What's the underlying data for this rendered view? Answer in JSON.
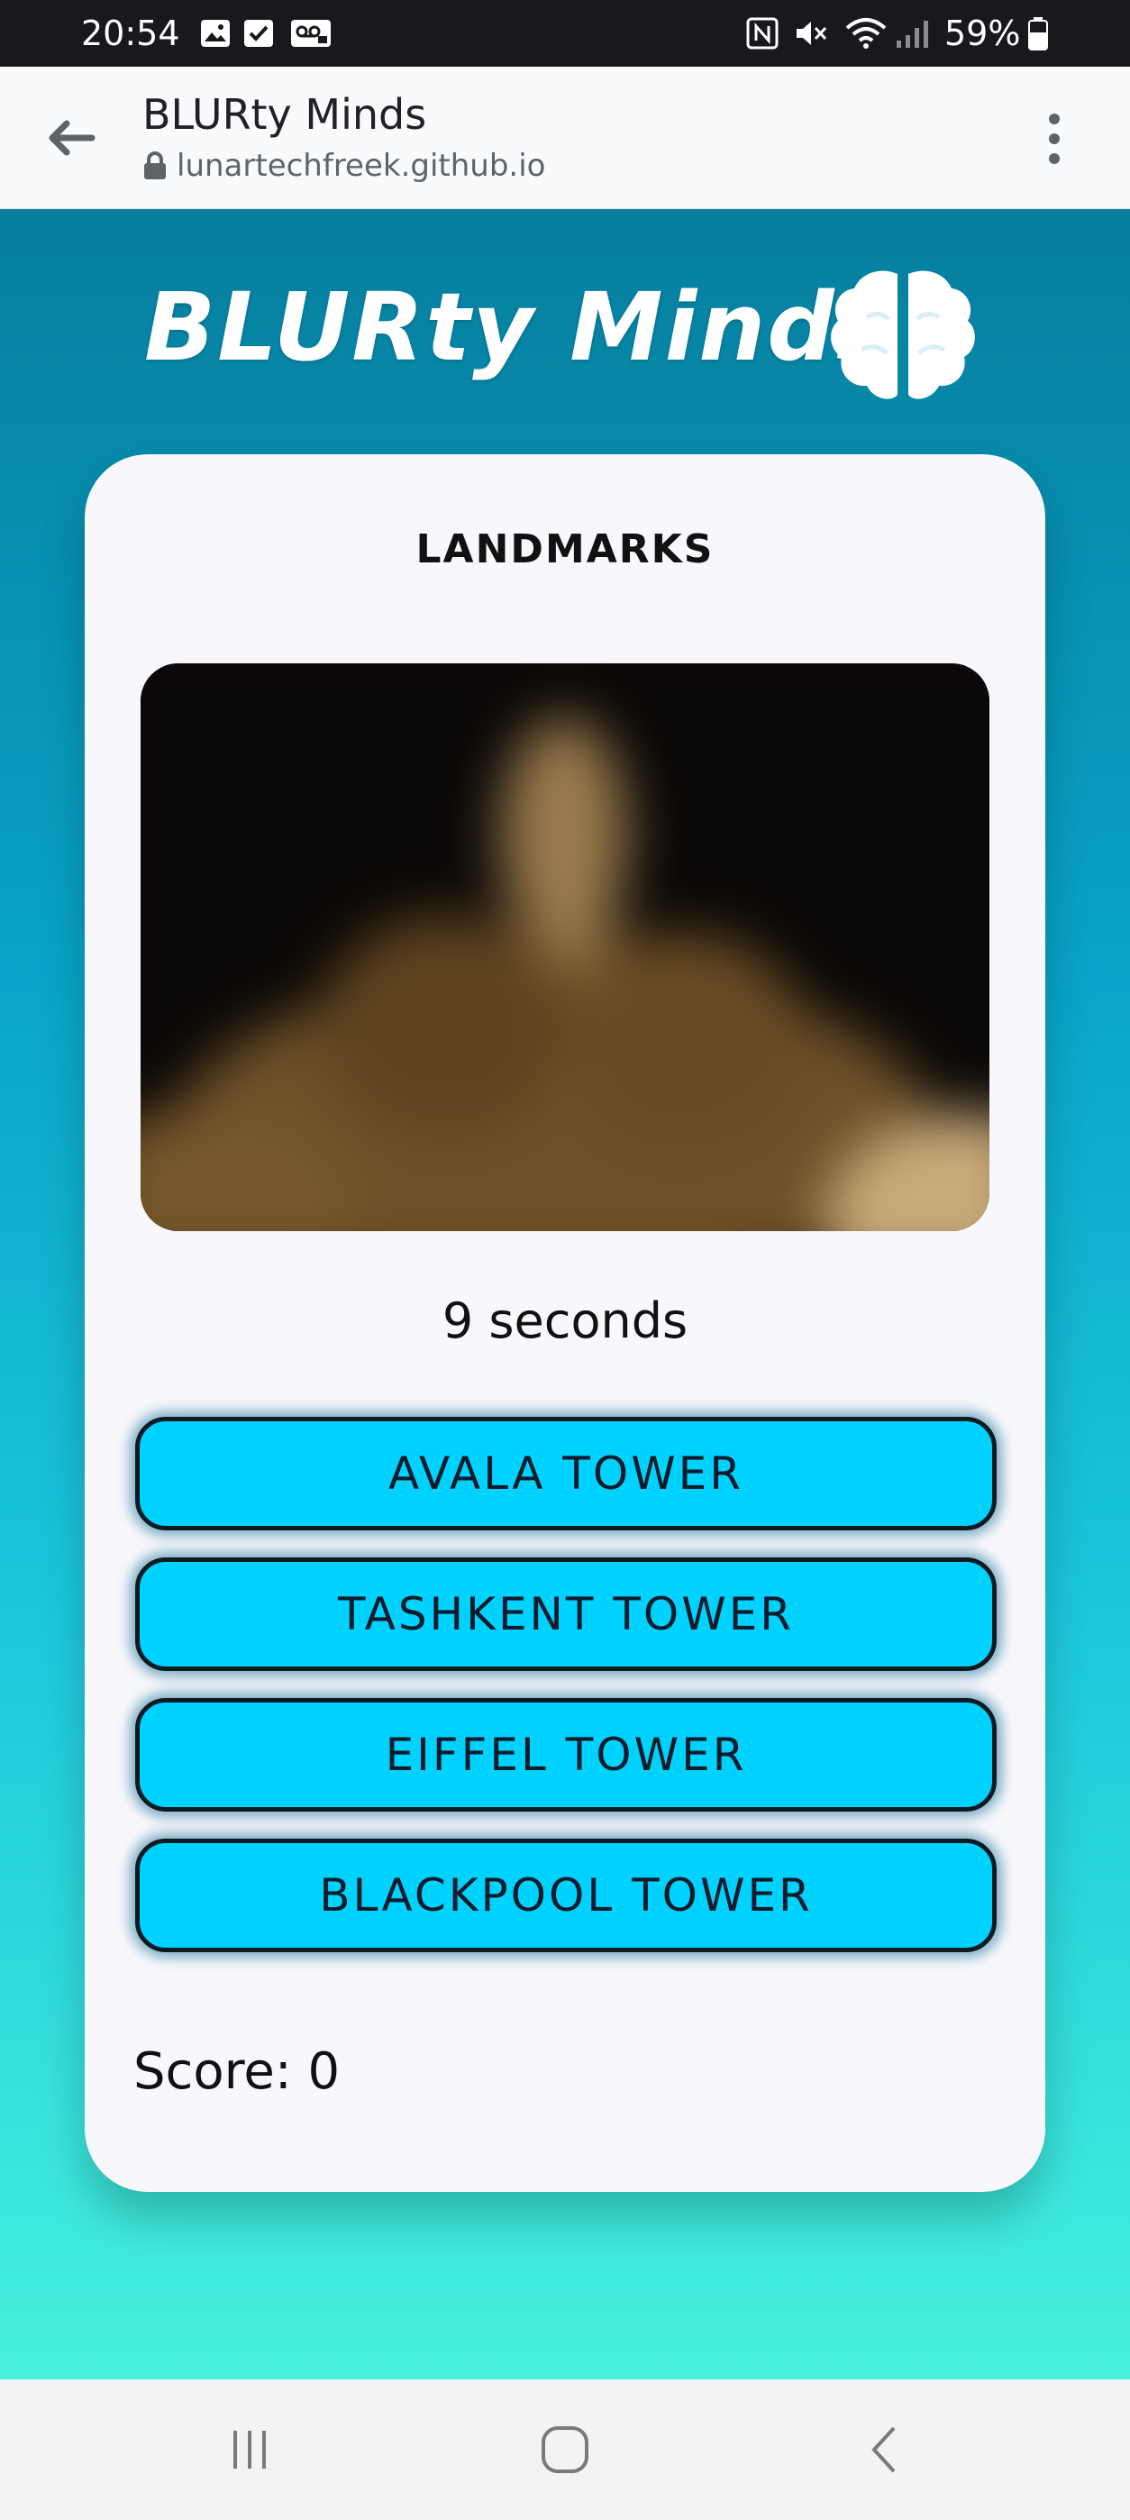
{
  "status_bar": {
    "time": "20:54",
    "battery": "59%",
    "icons": [
      "image-icon",
      "checkbox-icon",
      "voicemail-icon",
      "nfc-icon",
      "mute-icon",
      "wifi-icon",
      "signal-icon",
      "battery-icon"
    ]
  },
  "browser": {
    "title": "BLURty Minds",
    "url": "lunartechfreek.github.io",
    "back_icon": "arrow-left-icon",
    "menu_icon": "more-vert-icon",
    "lock_icon": "lock-icon"
  },
  "app": {
    "logo_text": "BLURty Minds",
    "logo_icon": "brain-icon",
    "category": "LANDMARKS",
    "timer": "9 seconds",
    "answers": [
      "AVALA TOWER",
      "TASHKENT TOWER",
      "EIFFEL TOWER",
      "BLACKPOOL TOWER"
    ],
    "score": "Score: 0"
  },
  "colors": {
    "gradient_top": "#077e9e",
    "gradient_bottom": "#46f1de",
    "button": "#00d2ff",
    "card": "#f8f8fc"
  },
  "nav_bar": {
    "icons": [
      "recent-apps-icon",
      "home-icon",
      "back-icon"
    ]
  }
}
